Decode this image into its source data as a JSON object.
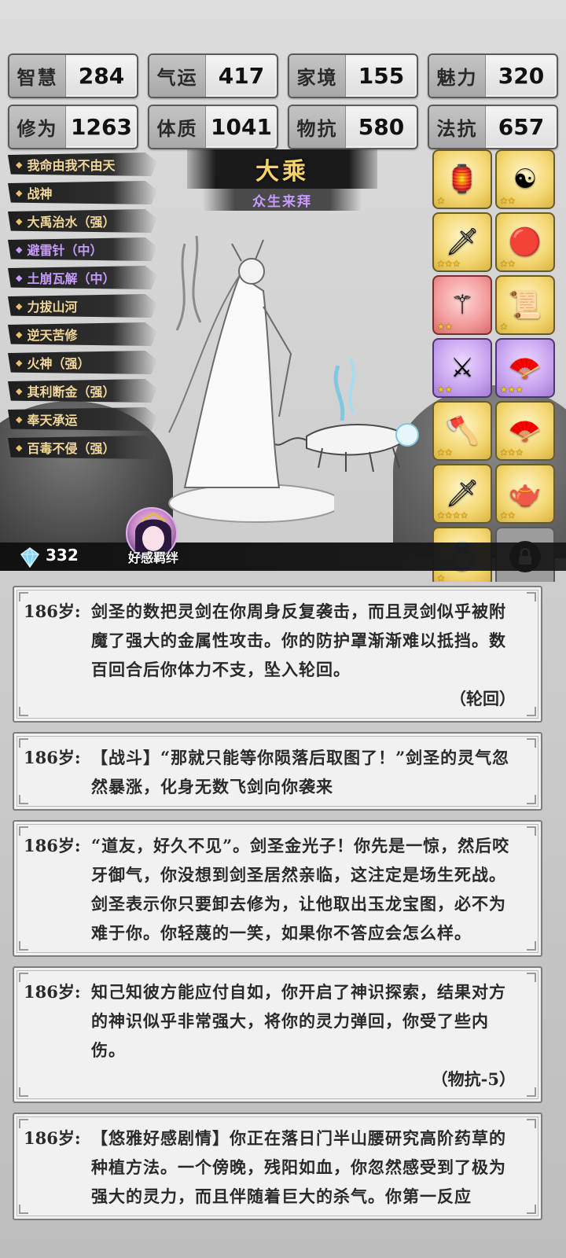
{
  "stats": [
    {
      "label": "智慧",
      "value": "284"
    },
    {
      "label": "气运",
      "value": "417"
    },
    {
      "label": "家境",
      "value": "155"
    },
    {
      "label": "魅力",
      "value": "320"
    },
    {
      "label": "修为",
      "value": "1263"
    },
    {
      "label": "体质",
      "value": "1041"
    },
    {
      "label": "物抗",
      "value": "580"
    },
    {
      "label": "法抗",
      "value": "657"
    }
  ],
  "rank": {
    "title": "大乘",
    "subtitle": "众生来拜"
  },
  "traits": [
    {
      "label": "我命由我不由天",
      "color": "gold"
    },
    {
      "label": "战神",
      "color": "gold"
    },
    {
      "label": "大禹治水（强）",
      "color": "gold"
    },
    {
      "label": "避雷针（中）",
      "color": "purple"
    },
    {
      "label": "土崩瓦解（中）",
      "color": "purple"
    },
    {
      "label": "力拔山河",
      "color": "gold"
    },
    {
      "label": "逆天苦修",
      "color": "gold"
    },
    {
      "label": "火神（强）",
      "color": "gold"
    },
    {
      "label": "其利断金（强）",
      "color": "gold"
    },
    {
      "label": "奉天承运",
      "color": "gold"
    },
    {
      "label": "百毒不侵（强）",
      "color": "gold"
    }
  ],
  "items": [
    {
      "icon": "lantern-artifact-icon",
      "glyph": "🏮",
      "stars": "★",
      "rarity": "gold"
    },
    {
      "icon": "yin-yang-orb-icon",
      "glyph": "☯",
      "stars": "★★",
      "rarity": "gold"
    },
    {
      "icon": "blue-flying-sword-icon",
      "glyph": "🗡",
      "stars": "★★★",
      "rarity": "gold"
    },
    {
      "icon": "red-fire-orb-icon",
      "glyph": "🔴",
      "stars": "★★",
      "rarity": "gold"
    },
    {
      "icon": "serpent-staff-icon",
      "glyph": "⚚",
      "stars": "★★",
      "rarity": "red"
    },
    {
      "icon": "scroll-icon",
      "glyph": "📜",
      "stars": "★",
      "rarity": "gold"
    },
    {
      "icon": "flame-sword-icon",
      "glyph": "⚔",
      "stars": "★★",
      "rarity": "purple"
    },
    {
      "icon": "palm-fan-icon",
      "glyph": "🪭",
      "stars": "★★★",
      "rarity": "purple"
    },
    {
      "icon": "battle-axe-icon",
      "glyph": "🪓",
      "stars": "★★",
      "rarity": "gold"
    },
    {
      "icon": "folding-fan-icon",
      "glyph": "🪭",
      "stars": "★★★",
      "rarity": "gold"
    },
    {
      "icon": "jade-sword-icon",
      "glyph": "🗡",
      "stars": "★★★★",
      "rarity": "gold"
    },
    {
      "icon": "teapot-icon",
      "glyph": "🫖",
      "stars": "★★",
      "rarity": "gold"
    },
    {
      "icon": "ruby-ring-icon",
      "glyph": "💍",
      "stars": "★",
      "rarity": "gold"
    },
    {
      "icon": "lock-icon",
      "glyph": "🔒",
      "stars": "",
      "rarity": "locked"
    }
  ],
  "currency": {
    "icon": "crystal-gem-icon",
    "value": "332"
  },
  "companion": {
    "label": "好感羁绊"
  },
  "log": [
    {
      "age": "186岁:",
      "text": "剑圣的数把灵剑在你周身反复袭击，而且灵剑似乎被附魔了强大的金属性攻击。你的防护罩渐渐难以抵挡。数百回合后你体力不支，坠入轮回。",
      "result": "（轮回）"
    },
    {
      "age": "186岁:",
      "text": "【战斗】“那就只能等你陨落后取图了！”剑圣的灵气忽然暴涨，化身无数飞剑向你袭来",
      "result": ""
    },
    {
      "age": "186岁:",
      "text": "“道友，好久不见”。剑圣金光子！你先是一惊，然后咬牙御气，你没想到剑圣居然亲临，这注定是场生死战。剑圣表示你只要卸去修为，让他取出玉龙宝图，必不为难于你。你轻蔑的一笑，如果你不答应会怎么样。",
      "result": ""
    },
    {
      "age": "186岁:",
      "text": "知己知彼方能应付自如，你开启了神识探索，结果对方的神识似乎非常强大，将你的灵力弹回，你受了些内伤。",
      "result": "（物抗-5）"
    },
    {
      "age": "186岁:",
      "text": "【悠雅好感剧情】你正在落日门半山腰研究高阶药草的种植方法。一个傍晚，残阳如血，你忽然感受到了极为强大的灵力，而且伴随着巨大的杀气。你第一反应",
      "result": ""
    }
  ],
  "colors": {
    "trait_gold": "#f2d79a",
    "trait_purple": "#c79bff",
    "rank_gold": "#f5d36b"
  }
}
